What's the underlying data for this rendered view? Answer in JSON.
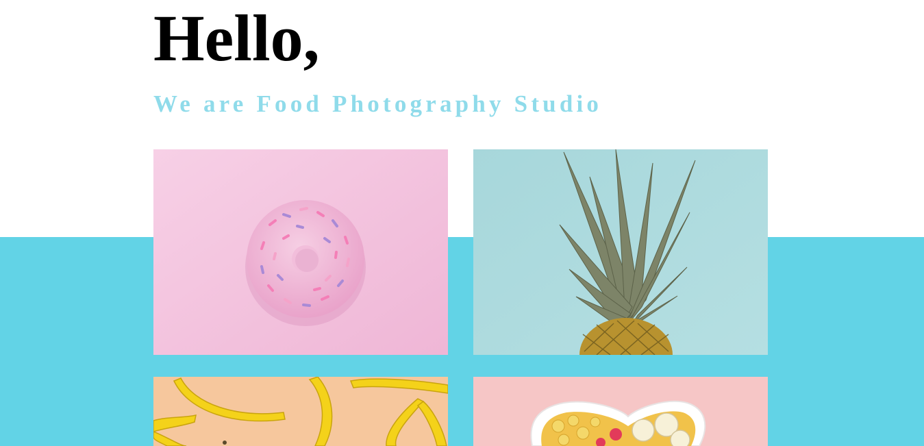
{
  "hero": {
    "heading": "Hello,",
    "subheading": "We are Food Photography Studio"
  },
  "colors": {
    "band": "#62d3e6",
    "subheading": "#8fdbea",
    "heading": "#000000"
  },
  "gallery": {
    "photos": [
      {
        "subject": "pink sprinkle donut on pink background",
        "icon": "donut-photo",
        "bg": "#f4c3df"
      },
      {
        "subject": "pineapple on light blue background",
        "icon": "pineapple-photo",
        "bg": "#a9d8dc"
      },
      {
        "subject": "bananas on peach background",
        "icon": "bananas-photo",
        "bg": "#f6c79d"
      },
      {
        "subject": "heart bowl of cereal and banana on pink background",
        "icon": "cereal-bowl-photo",
        "bg": "#f6c6c6"
      }
    ]
  }
}
